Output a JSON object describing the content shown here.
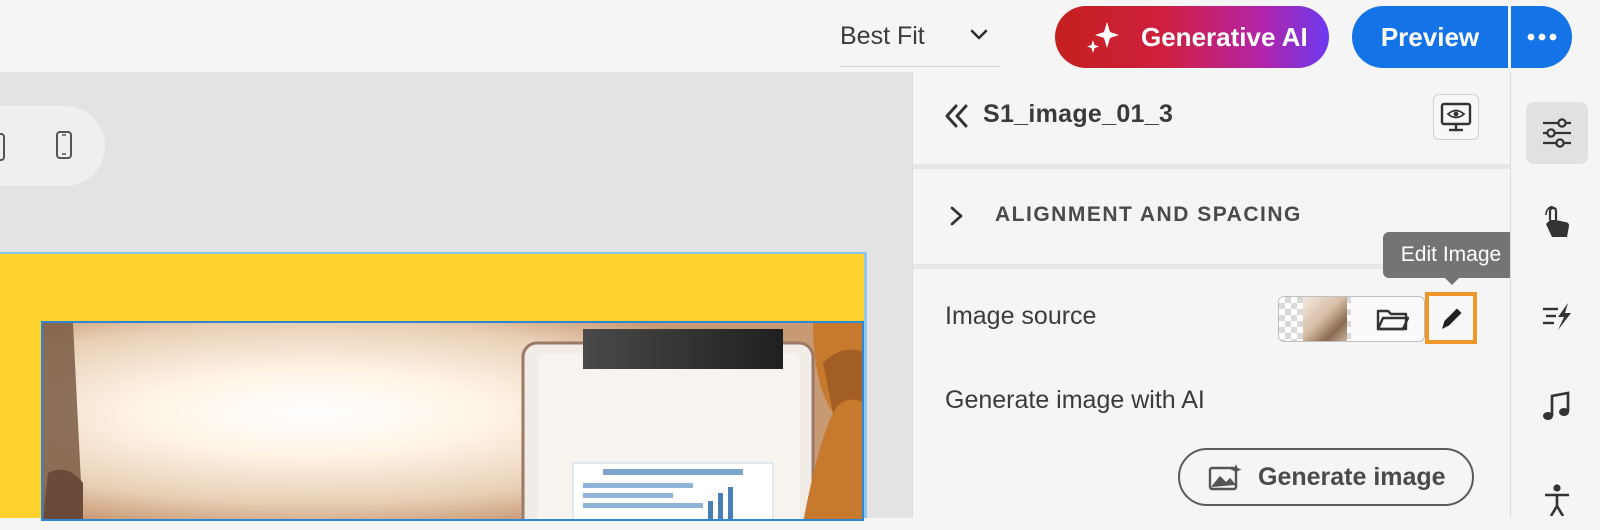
{
  "toolbar": {
    "zoom_value": "Best Fit",
    "generative_ai_label": "Generative AI",
    "preview_label": "Preview",
    "more_icon": "ellipsis-icon",
    "colors": {
      "preview_blue": "#1473e6",
      "genai_gradient_start": "#c4201f",
      "genai_gradient_end": "#6c3af0"
    }
  },
  "canvas": {
    "device_toolbar": {
      "icons": [
        "tablet-icon",
        "phone-icon"
      ]
    },
    "slide": {
      "background_color": "#ffd22e",
      "selection_color": "#2f86d6"
    }
  },
  "panel": {
    "title": "S1_image_01_3",
    "sections": [
      {
        "label": "ALIGNMENT AND SPACING",
        "expanded": false
      }
    ],
    "image_source_label": "Image source",
    "generate_with_ai_label": "Generate image with AI",
    "generate_image_button": "Generate image",
    "tooltip": "Edit Image",
    "highlight_color": "#f0952a"
  },
  "rail": {
    "items": [
      "properties-sliders-icon",
      "interaction-touch-icon",
      "effects-icon",
      "audio-icon",
      "accessibility-icon"
    ],
    "active": "properties-sliders-icon"
  }
}
